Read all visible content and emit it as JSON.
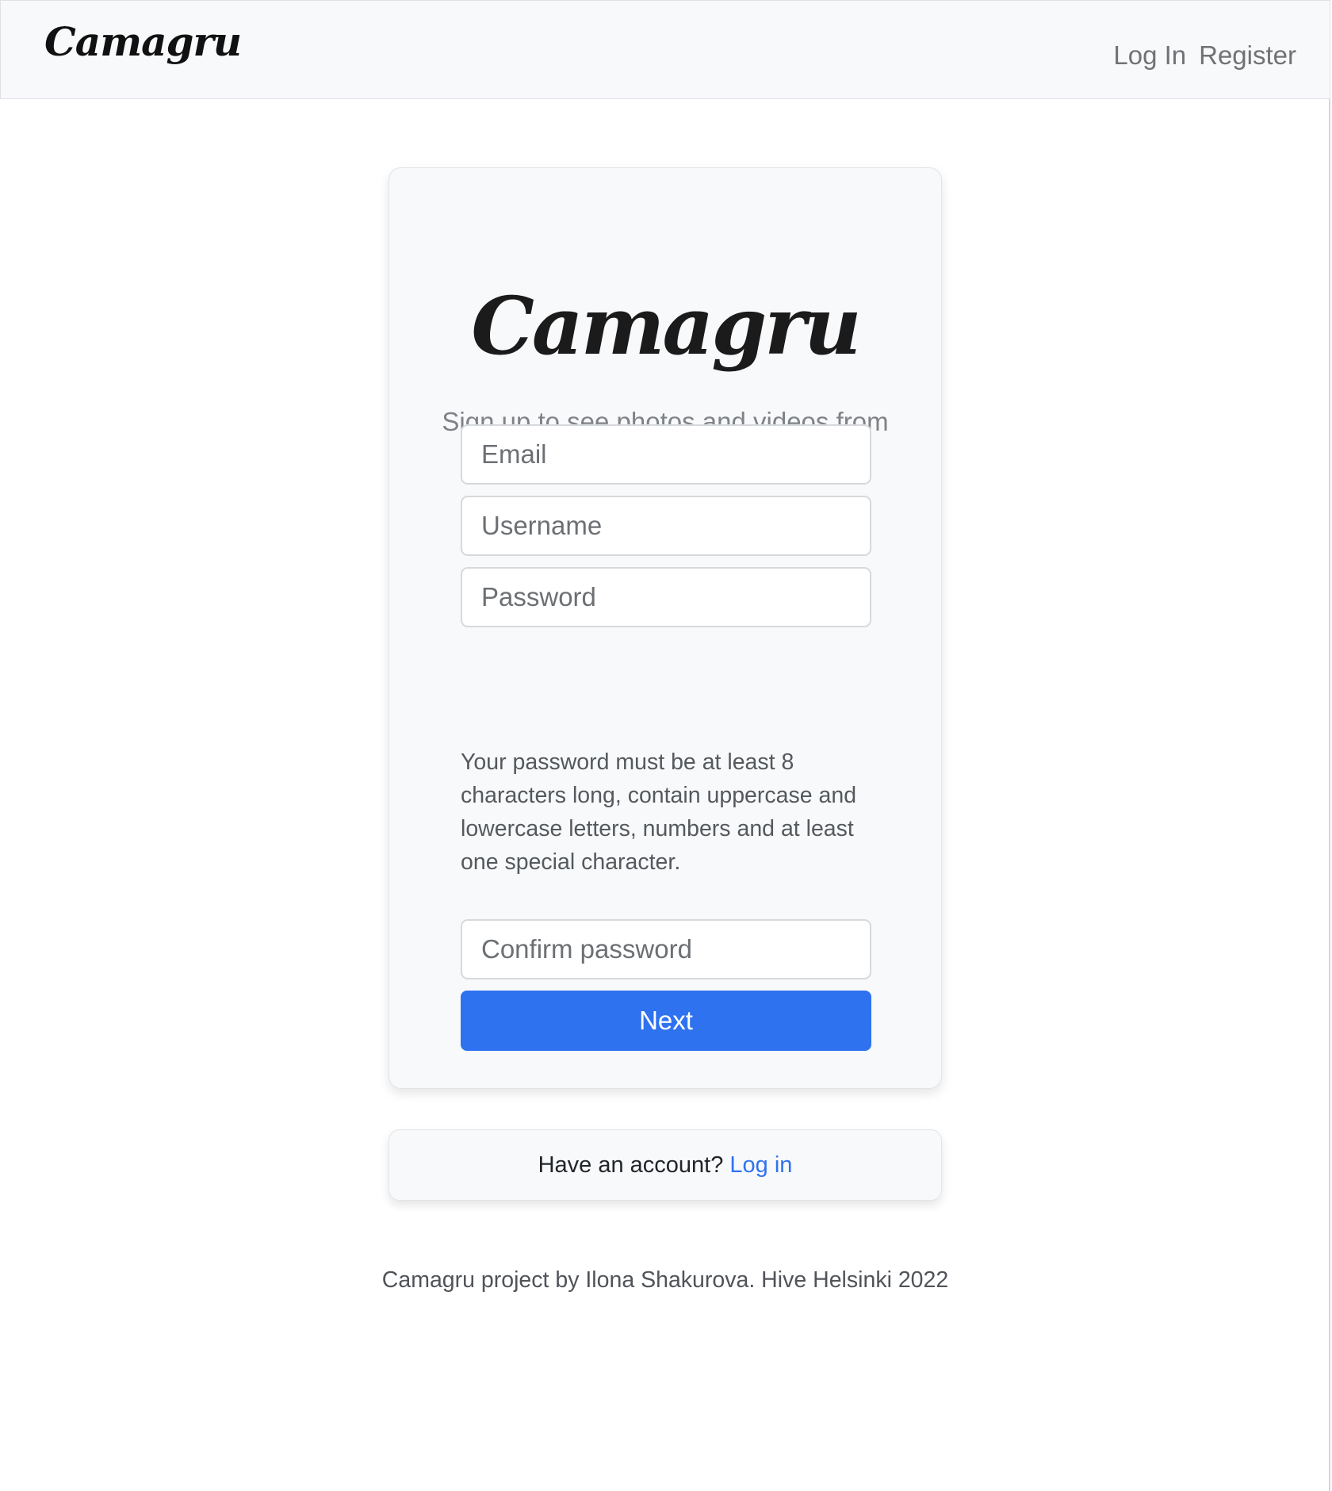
{
  "navbar": {
    "brand": "Camagru",
    "links": {
      "login": "Log In",
      "register": "Register"
    }
  },
  "signup": {
    "logo": "Camagru",
    "tagline": "Sign up to see photos and videos from your friends.",
    "email_placeholder": "Email",
    "username_placeholder": "Username",
    "password_placeholder": "Password",
    "password_hint": "Your password must be at least 8 characters long, contain uppercase and lowercase letters, numbers and at least one special character.",
    "confirm_placeholder": "Confirm password",
    "next_label": "Next"
  },
  "login_prompt": {
    "text": "Have an account?",
    "link": "Log in"
  },
  "footer": {
    "text": "Camagru project by Ilona Shakurova. Hive Helsinki 2022"
  },
  "colors": {
    "primary": "#2f72f0",
    "navbar_bg": "#f8f9fa",
    "card_bg": "#f8f9fa"
  }
}
